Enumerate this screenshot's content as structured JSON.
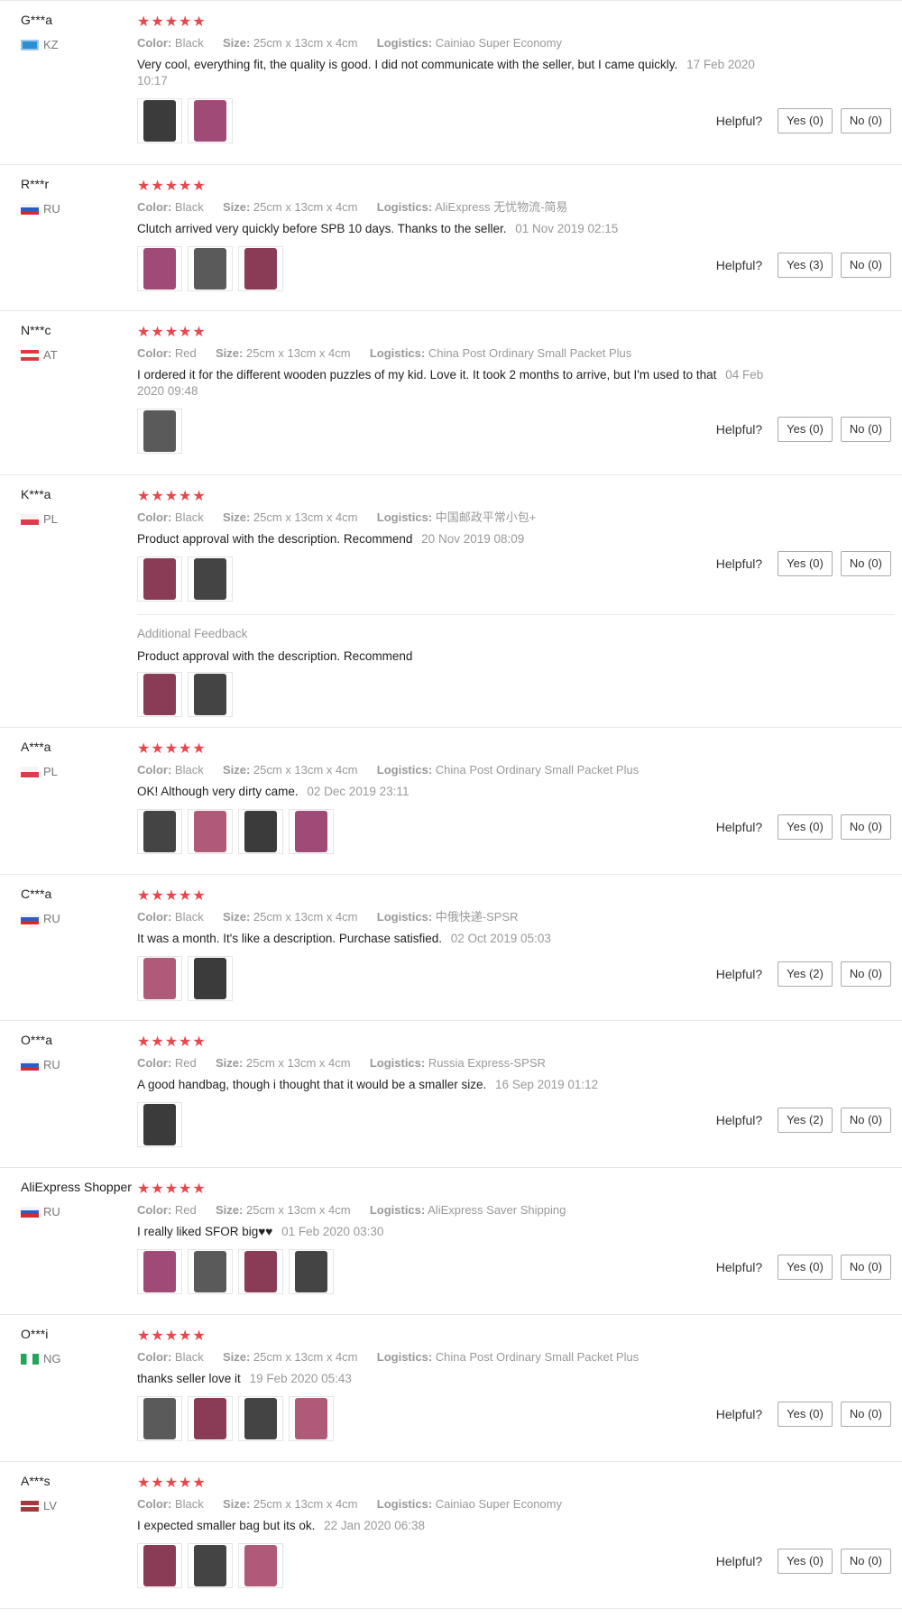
{
  "labels": {
    "color": "Color:",
    "size": "Size:",
    "logistics": "Logistics:",
    "helpful": "Helpful?",
    "additional_feedback": "Additional Feedback"
  },
  "rating_stars": "★★★★★",
  "reviews": [
    {
      "name": "G***a",
      "country": "KZ",
      "color": "Black",
      "size": "25cm x 13cm x 4cm",
      "logistics": "Cainiao Super Economy",
      "text": "Very cool, everything fit, the quality is good. I did not communicate with the seller, but I came quickly.",
      "date": "17 Feb 2020 10:17",
      "yes": "Yes (0)",
      "no": "No (0)",
      "photos": 2
    },
    {
      "name": "R***r",
      "country": "RU",
      "color": "Black",
      "size": "25cm x 13cm x 4cm",
      "logistics": "AliExpress 无忧物流-简易",
      "text": "Clutch arrived very quickly before SPB 10 days. Thanks to the seller.",
      "date": "01 Nov 2019 02:15",
      "yes": "Yes (3)",
      "no": "No (0)",
      "photos": 3
    },
    {
      "name": "N***c",
      "country": "AT",
      "color": "Red",
      "size": "25cm x 13cm x 4cm",
      "logistics": "China Post Ordinary Small Packet Plus",
      "text": "I ordered it for the different wooden puzzles of my kid. Love it. It took 2 months to arrive, but I'm used to that",
      "date": "04 Feb 2020 09:48",
      "yes": "Yes (0)",
      "no": "No (0)",
      "photos": 1
    },
    {
      "name": "K***a",
      "country": "PL",
      "color": "Black",
      "size": "25cm x 13cm x 4cm",
      "logistics": "中国邮政平常小包+",
      "text": "Product approval with the description. Recommend",
      "date": "20 Nov 2019 08:09",
      "yes": "Yes (0)",
      "no": "No (0)",
      "photos": 2,
      "additional_text": "Product approval with the description. Recommend"
    },
    {
      "name": "A***a",
      "country": "PL",
      "color": "Black",
      "size": "25cm x 13cm x 4cm",
      "logistics": "China Post Ordinary Small Packet Plus",
      "text": "OK! Although very dirty came.",
      "date": "02 Dec 2019 23:11",
      "yes": "Yes (0)",
      "no": "No (0)",
      "photos": 4
    },
    {
      "name": "C***a",
      "country": "RU",
      "color": "Black",
      "size": "25cm x 13cm x 4cm",
      "logistics": "中俄快递-SPSR",
      "text": "It was a month. It's like a description. Purchase satisfied.",
      "date": "02 Oct 2019 05:03",
      "yes": "Yes (2)",
      "no": "No (0)",
      "photos": 2
    },
    {
      "name": "O***a",
      "country": "RU",
      "color": "Red",
      "size": "25cm x 13cm x 4cm",
      "logistics": "Russia Express-SPSR",
      "text": "A good handbag, though i thought that it would be a smaller size.",
      "date": "16 Sep 2019 01:12",
      "yes": "Yes (2)",
      "no": "No (0)",
      "photos": 1
    },
    {
      "name": "AliExpress Shopper",
      "country": "RU",
      "color": "Red",
      "size": "25cm x 13cm x 4cm",
      "logistics": "AliExpress Saver Shipping",
      "text": "I really liked SFOR big♥♥",
      "date": "01 Feb 2020 03:30",
      "yes": "Yes (0)",
      "no": "No (0)",
      "photos": 4
    },
    {
      "name": "O***i",
      "country": "NG",
      "color": "Black",
      "size": "25cm x 13cm x 4cm",
      "logistics": "China Post Ordinary Small Packet Plus",
      "text": "thanks seller love it",
      "date": "19 Feb 2020 05:43",
      "yes": "Yes (0)",
      "no": "No (0)",
      "photos": 4
    },
    {
      "name": "A***s",
      "country": "LV",
      "color": "Black",
      "size": "25cm x 13cm x 4cm",
      "logistics": "Cainiao Super Economy",
      "text": "I expected smaller bag but its ok.",
      "date": "22 Jan 2020 06:38",
      "yes": "Yes (0)",
      "no": "No (0)",
      "photos": 3
    }
  ]
}
